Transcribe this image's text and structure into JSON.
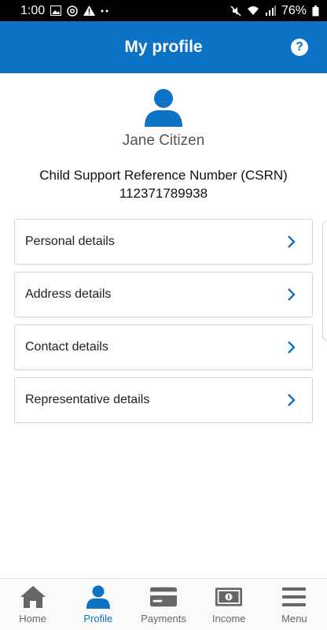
{
  "status_bar": {
    "time": "1:00",
    "battery": "76%"
  },
  "app_bar": {
    "title": "My profile",
    "help_icon": "?"
  },
  "profile": {
    "name": "Jane Citizen",
    "csrn_label": "Child Support Reference Number (CSRN)",
    "csrn_value": "112371789938"
  },
  "menu": [
    {
      "label": "Personal details"
    },
    {
      "label": "Address details"
    },
    {
      "label": "Contact details"
    },
    {
      "label": "Representative details"
    }
  ],
  "bottom_nav": [
    {
      "label": "Home",
      "icon": "home-icon"
    },
    {
      "label": "Profile",
      "icon": "profile-icon",
      "active": true
    },
    {
      "label": "Payments",
      "icon": "payments-icon"
    },
    {
      "label": "Income",
      "icon": "income-icon"
    },
    {
      "label": "Menu",
      "icon": "menu-icon"
    }
  ],
  "colors": {
    "brand": "#0b72c6",
    "nav_inactive": "#666666"
  }
}
